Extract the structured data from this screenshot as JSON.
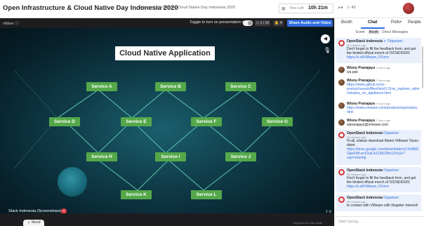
{
  "header": {
    "title": "Open Infrastructure & Cloud Native Day Indonesia 2020",
    "subtitle": "Open Infrastructure & Cloud Native Day Indonesia 2020",
    "time_left_label": "Time Left",
    "time_left_value": "10h 21m",
    "people_count": "43"
  },
  "stage": {
    "label": "vWare ⓘ",
    "presentation_toggle_text": "Toggle to turn on presentation mode",
    "presentation_mode_on": false,
    "viewer_count": "1 / 10",
    "raised_hands": "4",
    "share_button": "Share Audio and Video",
    "speaker_name": "Stack Indonesia (Screenshare)",
    "page_indicator": "1 d",
    "mood_label": "Mood",
    "hint": "Nugroho is in the stage"
  },
  "slide": {
    "title": "Cloud Native Application",
    "services": [
      "Service A",
      "Service B",
      "Service C",
      "Service D",
      "Service E",
      "Service F",
      "Service G",
      "Service H",
      "Service I",
      "Service J",
      "Service K",
      "Service L"
    ],
    "colors": {
      "service_box": "#55a84a",
      "line": "#5fc8b0",
      "background": "#0f3b48"
    }
  },
  "panel": {
    "tabs": [
      "Booth",
      "Chat",
      "Polls",
      "People"
    ],
    "active_tab": "Chat",
    "polls_badge": "•",
    "subtabs": [
      "Event",
      "Booth",
      "Direct Messages"
    ],
    "active_subtab": "Booth",
    "input_placeholder": "Start typing...",
    "messages": [
      {
        "name": "OpenStack Indonesia",
        "pin": "✔",
        "role": "Organiser ·",
        "time": "26 minutes ago",
        "lines": [
          "Don't forget to fill the feedback form, and get the limited official merch of OICNDI2020:"
        ],
        "link": "https://s.id/VMware_FForm",
        "pinned": true
      },
      {
        "name": "Wisnu Pranajaya",
        "time": "2 hours ago",
        "lines": [
          "iya pak"
        ]
      },
      {
        "name": "Wisnu Pranajaya",
        "time": "2 hours ago",
        "link": "https://www.github.io/vic-product/assets/files/html/1.5/vic_vsphere_admin/deploy_vic_appliance.html"
      },
      {
        "name": "Wisnu Pranajaya",
        "time": "2 hours ago",
        "link": "https://www.vmware.com/products/openstack.html"
      },
      {
        "name": "Wisnu Pranajaya",
        "time": "2 hours ago",
        "lines": [
          "wpranajaya@vmware.com"
        ]
      },
      {
        "name": "OpenStack Indonesia",
        "role": "Organiser ·",
        "time": "26 minutes ago",
        "lines": [
          "Hi all, silakan download Materi VMware Tanzu disini:"
        ],
        "link": "https://drive.google.com/drive/folders/1YkM8SGkpXWLecS1wLA133tU3Bs13Vq1s?usp=sharing",
        "pinned": true
      },
      {
        "name": "OpenStack Indonesia",
        "role": "Organiser ·",
        "time": "26 minutes ago",
        "lines": [
          "Don't forget to fill the feedback form, and get the limited official merch of OICNDI2020:"
        ],
        "link": "https://s.id/VMware_FForm",
        "pinned": true
      },
      {
        "name": "OpenStack Indonesia",
        "role": "Organiser ·",
        "time": "33 minutes ago",
        "lines": [
          "In contact with VMware with Register Interest!"
        ],
        "pinned": true
      }
    ]
  }
}
